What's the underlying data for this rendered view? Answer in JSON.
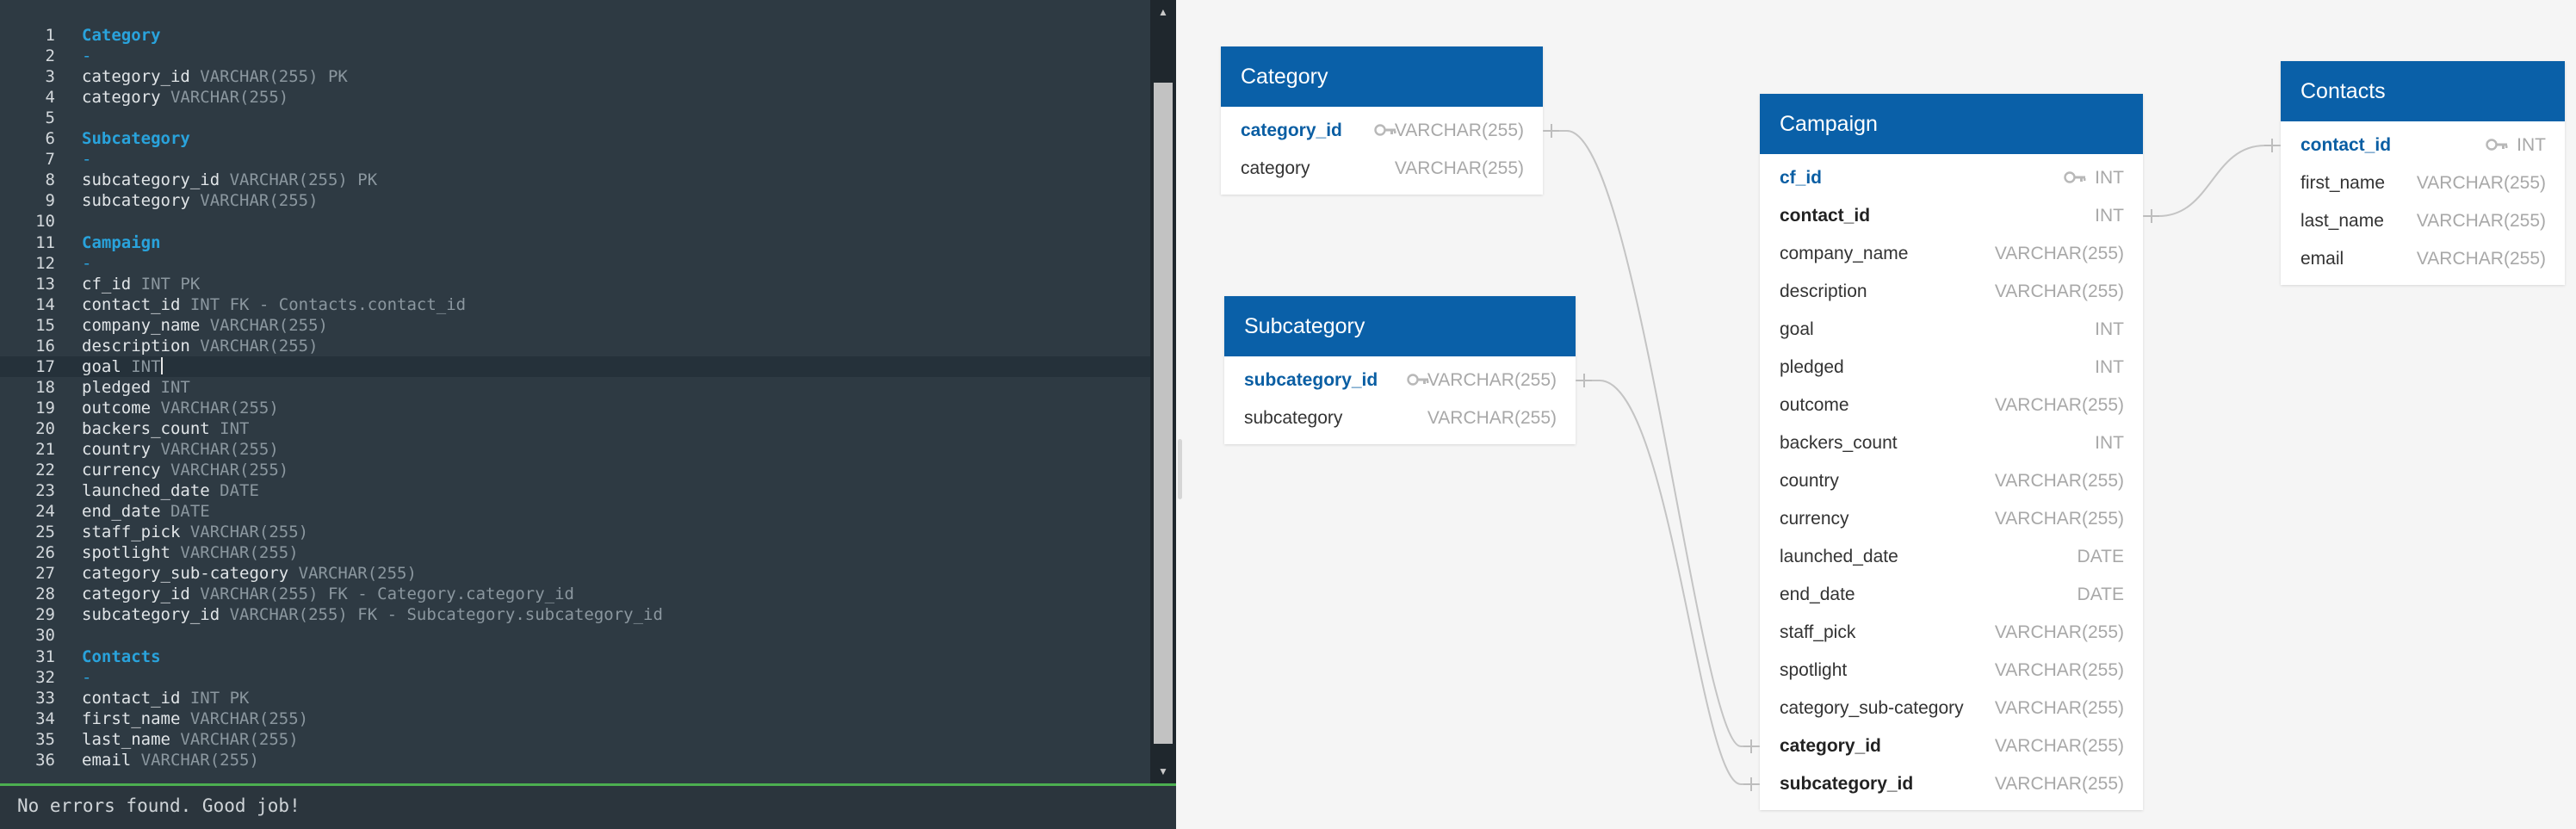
{
  "editor": {
    "lines": [
      {
        "num": "1",
        "kind": "header",
        "name": "Category",
        "type": ""
      },
      {
        "num": "2",
        "kind": "dash",
        "name": "-",
        "type": ""
      },
      {
        "num": "3",
        "kind": "field",
        "name": "category_id",
        "type": " VARCHAR(255) PK"
      },
      {
        "num": "4",
        "kind": "field",
        "name": "category",
        "type": " VARCHAR(255)"
      },
      {
        "num": "5",
        "kind": "blank",
        "name": "",
        "type": ""
      },
      {
        "num": "6",
        "kind": "header",
        "name": "Subcategory",
        "type": ""
      },
      {
        "num": "7",
        "kind": "dash",
        "name": "-",
        "type": ""
      },
      {
        "num": "8",
        "kind": "field",
        "name": "subcategory_id",
        "type": " VARCHAR(255) PK"
      },
      {
        "num": "9",
        "kind": "field",
        "name": "subcategory",
        "type": " VARCHAR(255)"
      },
      {
        "num": "10",
        "kind": "blank",
        "name": "",
        "type": ""
      },
      {
        "num": "11",
        "kind": "header",
        "name": "Campaign",
        "type": ""
      },
      {
        "num": "12",
        "kind": "dash",
        "name": "-",
        "type": ""
      },
      {
        "num": "13",
        "kind": "field",
        "name": "cf_id",
        "type": " INT PK"
      },
      {
        "num": "14",
        "kind": "field",
        "name": "contact_id",
        "type": " INT FK - Contacts.contact_id"
      },
      {
        "num": "15",
        "kind": "field",
        "name": "company_name",
        "type": " VARCHAR(255)"
      },
      {
        "num": "16",
        "kind": "field",
        "name": "description",
        "type": " VARCHAR(255)"
      },
      {
        "num": "17",
        "kind": "field",
        "name": "goal",
        "type": " INT",
        "active": true
      },
      {
        "num": "18",
        "kind": "field",
        "name": "pledged",
        "type": " INT"
      },
      {
        "num": "19",
        "kind": "field",
        "name": "outcome",
        "type": " VARCHAR(255)"
      },
      {
        "num": "20",
        "kind": "field",
        "name": "backers_count",
        "type": " INT"
      },
      {
        "num": "21",
        "kind": "field",
        "name": "country",
        "type": " VARCHAR(255)"
      },
      {
        "num": "22",
        "kind": "field",
        "name": "currency",
        "type": " VARCHAR(255)"
      },
      {
        "num": "23",
        "kind": "field",
        "name": "launched_date",
        "type": " DATE"
      },
      {
        "num": "24",
        "kind": "field",
        "name": "end_date",
        "type": " DATE"
      },
      {
        "num": "25",
        "kind": "field",
        "name": "staff_pick",
        "type": " VARCHAR(255)"
      },
      {
        "num": "26",
        "kind": "field",
        "name": "spotlight",
        "type": " VARCHAR(255)"
      },
      {
        "num": "27",
        "kind": "field",
        "name": "category_sub-category",
        "type": " VARCHAR(255)"
      },
      {
        "num": "28",
        "kind": "field",
        "name": "category_id",
        "type": " VARCHAR(255) FK - Category.category_id"
      },
      {
        "num": "29",
        "kind": "field",
        "name": "subcategory_id",
        "type": " VARCHAR(255) FK - Subcategory.subcategory_id"
      },
      {
        "num": "30",
        "kind": "blank",
        "name": "",
        "type": ""
      },
      {
        "num": "31",
        "kind": "header",
        "name": "Contacts",
        "type": ""
      },
      {
        "num": "32",
        "kind": "dash",
        "name": "-",
        "type": ""
      },
      {
        "num": "33",
        "kind": "field",
        "name": "contact_id",
        "type": " INT PK"
      },
      {
        "num": "34",
        "kind": "field",
        "name": "first_name",
        "type": " VARCHAR(255)"
      },
      {
        "num": "35",
        "kind": "field",
        "name": "last_name",
        "type": " VARCHAR(255)"
      },
      {
        "num": "36",
        "kind": "field",
        "name": "email",
        "type": " VARCHAR(255)"
      }
    ],
    "status": "No errors found. Good job!"
  },
  "scrollbar": {
    "up_icon": "triangle-up-icon",
    "down_icon": "triangle-down-icon"
  },
  "colors": {
    "editor_bg": "#2e3a43",
    "header_blue": "#29a3dc",
    "table_header": "#0a60a8",
    "pk_text": "#0a5ea3",
    "status_border": "#4caf50",
    "diagram_bg": "#f5f5f5"
  },
  "diagram": {
    "tables": [
      {
        "id": "category",
        "title": "Category",
        "fields": [
          {
            "name": "category_id",
            "type": "VARCHAR(255)",
            "key": "pk"
          },
          {
            "name": "category",
            "type": "VARCHAR(255)",
            "key": ""
          }
        ]
      },
      {
        "id": "subcategory",
        "title": "Subcategory",
        "fields": [
          {
            "name": "subcategory_id",
            "type": "VARCHAR(255)",
            "key": "pk"
          },
          {
            "name": "subcategory",
            "type": "VARCHAR(255)",
            "key": ""
          }
        ]
      },
      {
        "id": "campaign",
        "title": "Campaign",
        "fields": [
          {
            "name": "cf_id",
            "type": "INT",
            "key": "pk"
          },
          {
            "name": "contact_id",
            "type": "INT",
            "key": "fk"
          },
          {
            "name": "company_name",
            "type": "VARCHAR(255)",
            "key": ""
          },
          {
            "name": "description",
            "type": "VARCHAR(255)",
            "key": ""
          },
          {
            "name": "goal",
            "type": "INT",
            "key": ""
          },
          {
            "name": "pledged",
            "type": "INT",
            "key": ""
          },
          {
            "name": "outcome",
            "type": "VARCHAR(255)",
            "key": ""
          },
          {
            "name": "backers_count",
            "type": "INT",
            "key": ""
          },
          {
            "name": "country",
            "type": "VARCHAR(255)",
            "key": ""
          },
          {
            "name": "currency",
            "type": "VARCHAR(255)",
            "key": ""
          },
          {
            "name": "launched_date",
            "type": "DATE",
            "key": ""
          },
          {
            "name": "end_date",
            "type": "DATE",
            "key": ""
          },
          {
            "name": "staff_pick",
            "type": "VARCHAR(255)",
            "key": ""
          },
          {
            "name": "spotlight",
            "type": "VARCHAR(255)",
            "key": ""
          },
          {
            "name": "category_sub-category",
            "type": "VARCHAR(255)",
            "key": ""
          },
          {
            "name": "category_id",
            "type": "VARCHAR(255)",
            "key": "fk"
          },
          {
            "name": "subcategory_id",
            "type": "VARCHAR(255)",
            "key": "fk"
          }
        ]
      },
      {
        "id": "contacts",
        "title": "Contacts",
        "fields": [
          {
            "name": "contact_id",
            "type": "INT",
            "key": "pk"
          },
          {
            "name": "first_name",
            "type": "VARCHAR(255)",
            "key": ""
          },
          {
            "name": "last_name",
            "type": "VARCHAR(255)",
            "key": ""
          },
          {
            "name": "email",
            "type": "VARCHAR(255)",
            "key": ""
          }
        ]
      }
    ],
    "relationships": [
      {
        "from": "campaign.contact_id",
        "to": "contacts.contact_id"
      },
      {
        "from": "campaign.category_id",
        "to": "category.category_id"
      },
      {
        "from": "campaign.subcategory_id",
        "to": "subcategory.subcategory_id"
      }
    ]
  }
}
